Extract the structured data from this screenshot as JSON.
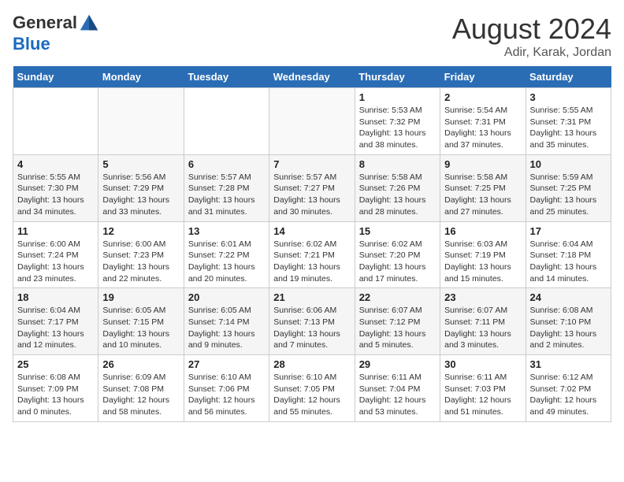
{
  "logo": {
    "general": "General",
    "blue": "Blue"
  },
  "header": {
    "month": "August 2024",
    "location": "Adir, Karak, Jordan"
  },
  "weekdays": [
    "Sunday",
    "Monday",
    "Tuesday",
    "Wednesday",
    "Thursday",
    "Friday",
    "Saturday"
  ],
  "weeks": [
    [
      {
        "day": "",
        "sunrise": "",
        "sunset": "",
        "daylight": "",
        "empty": true
      },
      {
        "day": "",
        "sunrise": "",
        "sunset": "",
        "daylight": "",
        "empty": true
      },
      {
        "day": "",
        "sunrise": "",
        "sunset": "",
        "daylight": "",
        "empty": true
      },
      {
        "day": "",
        "sunrise": "",
        "sunset": "",
        "daylight": "",
        "empty": true
      },
      {
        "day": "1",
        "sunrise": "5:53 AM",
        "sunset": "7:32 PM",
        "daylight": "13 hours and 38 minutes."
      },
      {
        "day": "2",
        "sunrise": "5:54 AM",
        "sunset": "7:31 PM",
        "daylight": "13 hours and 37 minutes."
      },
      {
        "day": "3",
        "sunrise": "5:55 AM",
        "sunset": "7:31 PM",
        "daylight": "13 hours and 35 minutes."
      }
    ],
    [
      {
        "day": "4",
        "sunrise": "5:55 AM",
        "sunset": "7:30 PM",
        "daylight": "13 hours and 34 minutes."
      },
      {
        "day": "5",
        "sunrise": "5:56 AM",
        "sunset": "7:29 PM",
        "daylight": "13 hours and 33 minutes."
      },
      {
        "day": "6",
        "sunrise": "5:57 AM",
        "sunset": "7:28 PM",
        "daylight": "13 hours and 31 minutes."
      },
      {
        "day": "7",
        "sunrise": "5:57 AM",
        "sunset": "7:27 PM",
        "daylight": "13 hours and 30 minutes."
      },
      {
        "day": "8",
        "sunrise": "5:58 AM",
        "sunset": "7:26 PM",
        "daylight": "13 hours and 28 minutes."
      },
      {
        "day": "9",
        "sunrise": "5:58 AM",
        "sunset": "7:25 PM",
        "daylight": "13 hours and 27 minutes."
      },
      {
        "day": "10",
        "sunrise": "5:59 AM",
        "sunset": "7:25 PM",
        "daylight": "13 hours and 25 minutes."
      }
    ],
    [
      {
        "day": "11",
        "sunrise": "6:00 AM",
        "sunset": "7:24 PM",
        "daylight": "13 hours and 23 minutes."
      },
      {
        "day": "12",
        "sunrise": "6:00 AM",
        "sunset": "7:23 PM",
        "daylight": "13 hours and 22 minutes."
      },
      {
        "day": "13",
        "sunrise": "6:01 AM",
        "sunset": "7:22 PM",
        "daylight": "13 hours and 20 minutes."
      },
      {
        "day": "14",
        "sunrise": "6:02 AM",
        "sunset": "7:21 PM",
        "daylight": "13 hours and 19 minutes."
      },
      {
        "day": "15",
        "sunrise": "6:02 AM",
        "sunset": "7:20 PM",
        "daylight": "13 hours and 17 minutes."
      },
      {
        "day": "16",
        "sunrise": "6:03 AM",
        "sunset": "7:19 PM",
        "daylight": "13 hours and 15 minutes."
      },
      {
        "day": "17",
        "sunrise": "6:04 AM",
        "sunset": "7:18 PM",
        "daylight": "13 hours and 14 minutes."
      }
    ],
    [
      {
        "day": "18",
        "sunrise": "6:04 AM",
        "sunset": "7:17 PM",
        "daylight": "13 hours and 12 minutes."
      },
      {
        "day": "19",
        "sunrise": "6:05 AM",
        "sunset": "7:15 PM",
        "daylight": "13 hours and 10 minutes."
      },
      {
        "day": "20",
        "sunrise": "6:05 AM",
        "sunset": "7:14 PM",
        "daylight": "13 hours and 9 minutes."
      },
      {
        "day": "21",
        "sunrise": "6:06 AM",
        "sunset": "7:13 PM",
        "daylight": "13 hours and 7 minutes."
      },
      {
        "day": "22",
        "sunrise": "6:07 AM",
        "sunset": "7:12 PM",
        "daylight": "13 hours and 5 minutes."
      },
      {
        "day": "23",
        "sunrise": "6:07 AM",
        "sunset": "7:11 PM",
        "daylight": "13 hours and 3 minutes."
      },
      {
        "day": "24",
        "sunrise": "6:08 AM",
        "sunset": "7:10 PM",
        "daylight": "13 hours and 2 minutes."
      }
    ],
    [
      {
        "day": "25",
        "sunrise": "6:08 AM",
        "sunset": "7:09 PM",
        "daylight": "13 hours and 0 minutes."
      },
      {
        "day": "26",
        "sunrise": "6:09 AM",
        "sunset": "7:08 PM",
        "daylight": "12 hours and 58 minutes."
      },
      {
        "day": "27",
        "sunrise": "6:10 AM",
        "sunset": "7:06 PM",
        "daylight": "12 hours and 56 minutes."
      },
      {
        "day": "28",
        "sunrise": "6:10 AM",
        "sunset": "7:05 PM",
        "daylight": "12 hours and 55 minutes."
      },
      {
        "day": "29",
        "sunrise": "6:11 AM",
        "sunset": "7:04 PM",
        "daylight": "12 hours and 53 minutes."
      },
      {
        "day": "30",
        "sunrise": "6:11 AM",
        "sunset": "7:03 PM",
        "daylight": "12 hours and 51 minutes."
      },
      {
        "day": "31",
        "sunrise": "6:12 AM",
        "sunset": "7:02 PM",
        "daylight": "12 hours and 49 minutes."
      }
    ]
  ],
  "labels": {
    "sunrise": "Sunrise:",
    "sunset": "Sunset:",
    "daylight": "Daylight:"
  }
}
